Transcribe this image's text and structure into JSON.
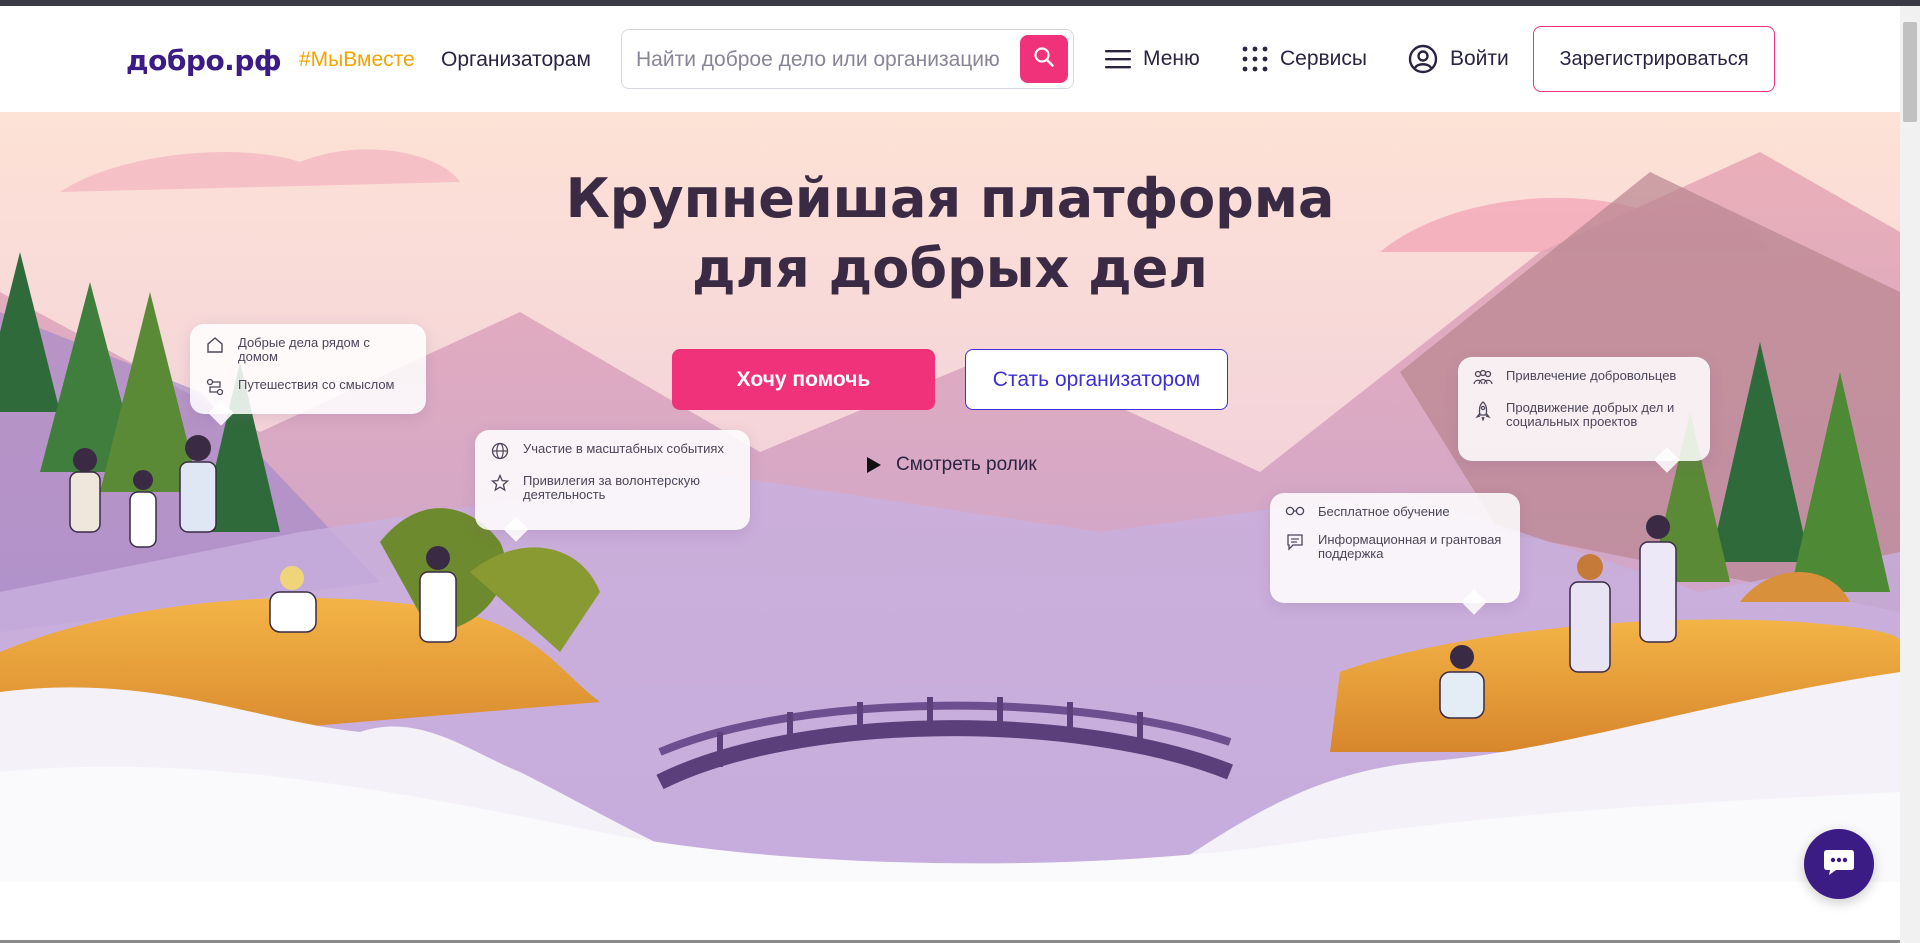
{
  "header": {
    "logo": "добро.рф",
    "tag": "#МыВместе",
    "organizers_link": "Организаторам",
    "search_placeholder": "Найти доброе дело или организацию",
    "menu_label": "Меню",
    "services_label": "Сервисы",
    "login_label": "Войти",
    "register_label": "Зарегистрироваться"
  },
  "hero": {
    "title_line1": "Крупнейшая платформа",
    "title_line2": "для добрых дел",
    "help_button": "Хочу помочь",
    "organizer_button": "Стать организатором",
    "watch_video": "Смотреть ролик"
  },
  "bubbles": {
    "b1": [
      "Добрые дела рядом с домом",
      "Путешествия со смыслом"
    ],
    "b2": [
      "Участие в масштабных событиях",
      "Привилегия за волонтерскую деятельность"
    ],
    "b3": [
      "Привлечение добровольцев",
      "Продвижение добрых дел и социальных проектов"
    ],
    "b4": [
      "Бесплатное обучение",
      "Информационная и грантовая поддержка"
    ]
  },
  "colors": {
    "brand_purple": "#3b1c84",
    "accent_pink": "#f0327a",
    "tag_orange": "#f5a300",
    "organizer_blue": "#3d2fd6"
  },
  "icons": {
    "search": "search-icon",
    "menu": "hamburger-icon",
    "services": "grid-dots-icon",
    "login": "user-circle-icon",
    "play": "play-icon",
    "chat": "chat-icon"
  }
}
